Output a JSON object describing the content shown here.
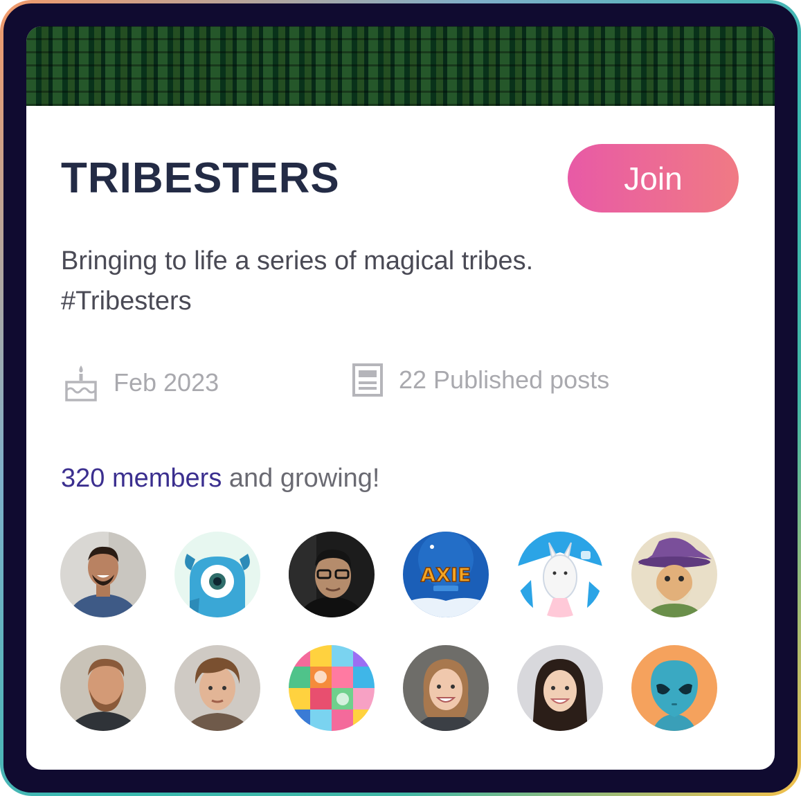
{
  "community": {
    "name": "TRIBESTERS",
    "join_label": "Join",
    "description_line1": "Bringing to life a series of magical tribes.",
    "description_line2": "#Tribesters"
  },
  "meta": {
    "created_icon": "birthday-cake-icon",
    "created": "Feb 2023",
    "posts_icon": "document-icon",
    "posts": "22 Published posts"
  },
  "members": {
    "count_label": "320 members",
    "suffix": " and growing!"
  },
  "avatars": [
    {
      "name": "member-avatar-1",
      "kind": "photo-smiling-man"
    },
    {
      "name": "member-avatar-2",
      "kind": "blue-monster"
    },
    {
      "name": "member-avatar-3",
      "kind": "photo-man-glasses"
    },
    {
      "name": "member-avatar-4",
      "kind": "axie-logo"
    },
    {
      "name": "member-avatar-5",
      "kind": "white-creature"
    },
    {
      "name": "member-avatar-6",
      "kind": "wizard-character"
    },
    {
      "name": "member-avatar-7",
      "kind": "photo-bearded-man"
    },
    {
      "name": "member-avatar-8",
      "kind": "photo-young-man"
    },
    {
      "name": "member-avatar-9",
      "kind": "pixel-characters-grid"
    },
    {
      "name": "member-avatar-10",
      "kind": "photo-woman"
    },
    {
      "name": "member-avatar-11",
      "kind": "photo-woman-2"
    },
    {
      "name": "member-avatar-12",
      "kind": "alien-icon"
    }
  ],
  "colors": {
    "join_gradient_start": "#e85aa6",
    "join_gradient_end": "#f07a84",
    "title": "#232b45",
    "member_count": "#3b2f8f",
    "frame": "#100b30"
  }
}
